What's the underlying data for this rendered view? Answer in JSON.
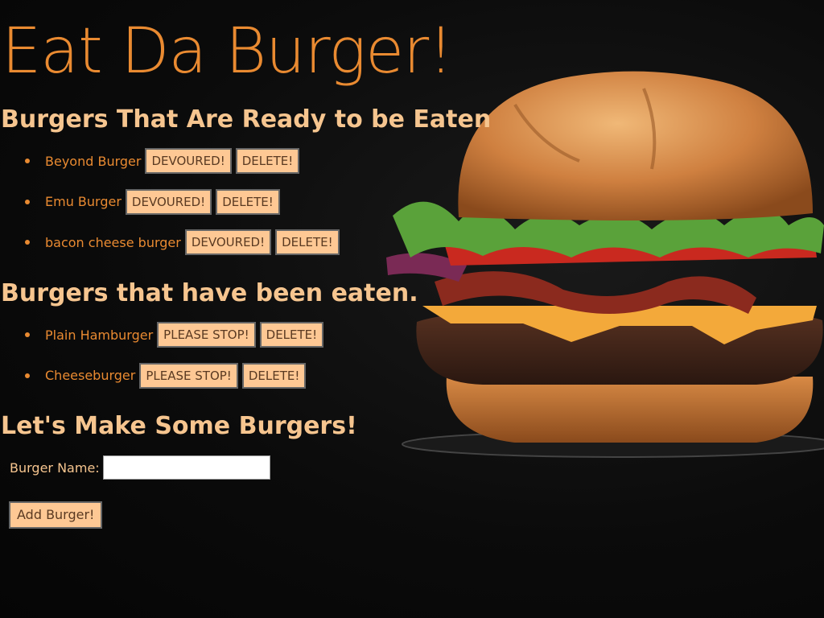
{
  "header": {
    "title": "Eat Da Burger!"
  },
  "ready": {
    "heading": "Burgers That Are Ready to be Eaten",
    "items": [
      {
        "name": "Beyond Burger",
        "action": "DEVOURED!",
        "delete": "DELETE!"
      },
      {
        "name": "Emu Burger",
        "action": "DEVOURED!",
        "delete": "DELETE!"
      },
      {
        "name": "bacon cheese burger",
        "action": "DEVOURED!",
        "delete": "DELETE!"
      }
    ]
  },
  "eaten": {
    "heading": "Burgers that have been eaten.",
    "items": [
      {
        "name": "Plain Hamburger",
        "action": "PLEASE STOP!",
        "delete": "DELETE!"
      },
      {
        "name": "Cheeseburger",
        "action": "PLEASE STOP!",
        "delete": "DELETE!"
      }
    ]
  },
  "form": {
    "heading": "Let's Make Some Burgers!",
    "name_label": "Burger Name:",
    "name_value": "",
    "submit_label": "Add Burger!"
  },
  "colors": {
    "title": "#e98a31",
    "heading": "#f6c58f",
    "button_bg": "#fec894",
    "background": "#000000"
  }
}
